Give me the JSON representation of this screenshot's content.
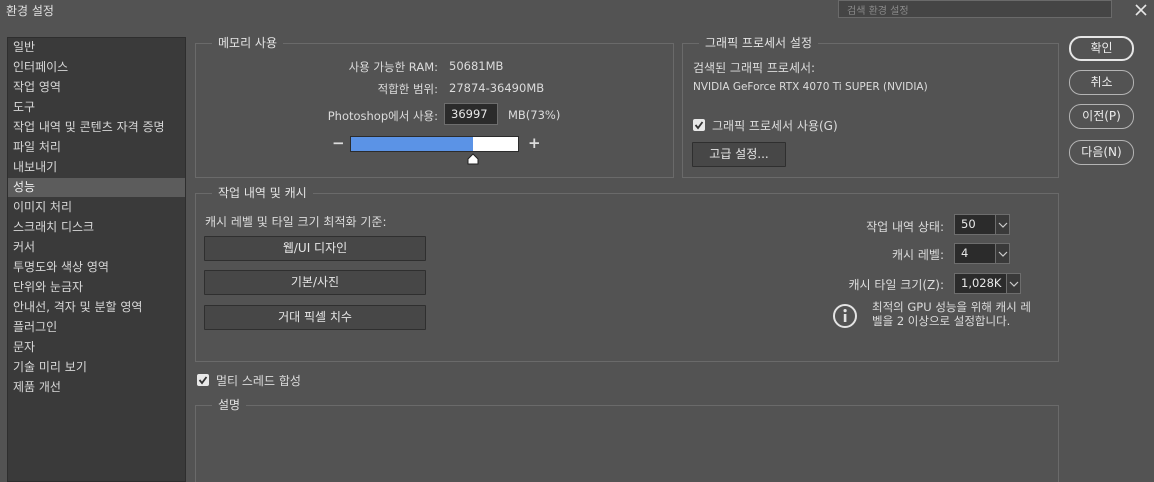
{
  "window": {
    "title": "환경 설정",
    "search_placeholder": "검색 환경 설정"
  },
  "sidebar": {
    "items": [
      {
        "label": "일반"
      },
      {
        "label": "인터페이스"
      },
      {
        "label": "작업 영역"
      },
      {
        "label": "도구"
      },
      {
        "label": "작업 내역 및 콘텐츠 자격 증명"
      },
      {
        "label": "파일 처리"
      },
      {
        "label": "내보내기"
      },
      {
        "label": "성능",
        "selected": true
      },
      {
        "label": "이미지 처리"
      },
      {
        "label": "스크래치 디스크"
      },
      {
        "label": "커서"
      },
      {
        "label": "투명도와 색상 영역"
      },
      {
        "label": "단위와 눈금자"
      },
      {
        "label": "안내선, 격자 및 분할 영역"
      },
      {
        "label": "플러그인"
      },
      {
        "label": "문자"
      },
      {
        "label": "기술 미리 보기"
      },
      {
        "label": "제품 개선"
      }
    ]
  },
  "memory": {
    "legend": "메모리 사용",
    "ram_label": "사용 가능한 RAM:",
    "ram_value": "50681MB",
    "range_label": "적합한 범위:",
    "range_value": "27874-36490MB",
    "usage_label": "Photoshop에서 사용:",
    "usage_value": "36997",
    "usage_unit": "MB(73%)",
    "minus": "−",
    "plus": "+",
    "slider_fraction": 0.73
  },
  "gpu": {
    "legend": "그래픽 프로세서 설정",
    "detected_label": "검색된 그래픽 프로세서:",
    "gpu_name": "NVIDIA GeForce RTX 4070 Ti SUPER (NVIDIA)",
    "use_gpu_label": "그래픽 프로세서 사용(G)",
    "use_gpu_checked": true,
    "advanced_button": "고급 설정..."
  },
  "history_cache": {
    "legend": "작업 내역 및 캐시",
    "optimize_label": "캐시 레벨 및 타일 크기 최적화 기준:",
    "presets": [
      "웹/UI 디자인",
      "기본/사진",
      "거대 픽셀 치수"
    ],
    "history_states_label": "작업 내역 상태:",
    "history_states_value": "50",
    "cache_levels_label": "캐시 레벨:",
    "cache_levels_value": "4",
    "tile_size_label": "캐시 타일 크기(Z):",
    "tile_size_value": "1,028K",
    "info_line1": "최적의 GPU 성능을 위해 캐시 레",
    "info_line2": "벨을 2 이상으로 설정합니다."
  },
  "multithread": {
    "label": "멀티 스레드 합성",
    "checked": true
  },
  "description": {
    "legend": "설명"
  },
  "dialog_buttons": {
    "ok": "확인",
    "cancel": "취소",
    "prev": "이전(P)",
    "next": "다음(N)"
  },
  "colors": {
    "bg": "#535353",
    "slider_fill": "#5b93e6",
    "sidebar_bg": "#3a3a3a",
    "selected_item": "#5c5c5c"
  },
  "icons": [
    "close-icon",
    "minus-icon",
    "plus-icon",
    "slider-handle-icon",
    "checkbox-check-icon",
    "chevron-down-icon",
    "info-icon"
  ]
}
